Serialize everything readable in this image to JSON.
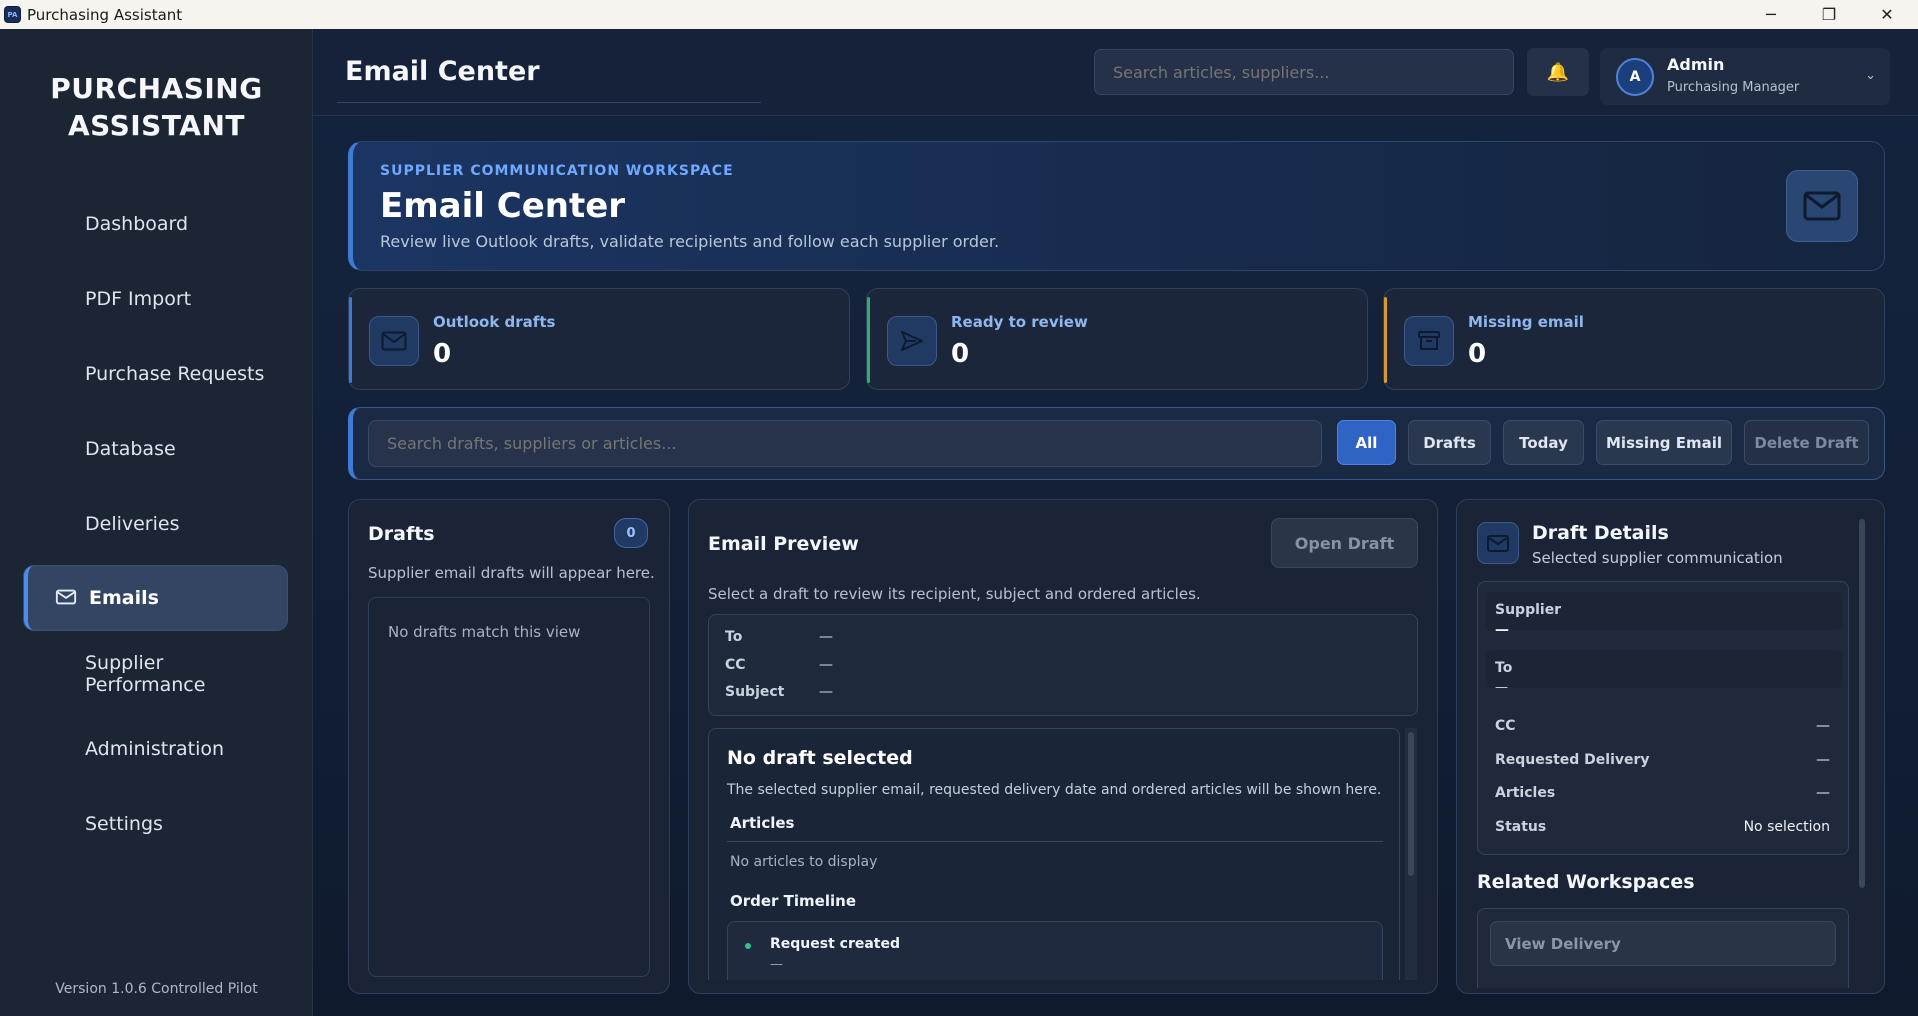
{
  "window": {
    "title": "Purchasing Assistant",
    "app_icon_text": "PA",
    "controls": {
      "minimize": "─",
      "maximize": "❐",
      "close": "✕"
    }
  },
  "sidebar": {
    "brand_line1": "PURCHASING",
    "brand_line2": "ASSISTANT",
    "items": [
      {
        "label": "Dashboard"
      },
      {
        "label": "PDF Import"
      },
      {
        "label": "Purchase Requests"
      },
      {
        "label": "Database"
      },
      {
        "label": "Deliveries"
      },
      {
        "label": "Emails",
        "active": true,
        "icon": "envelope-icon"
      },
      {
        "label": "Supplier Performance"
      },
      {
        "label": "Administration"
      },
      {
        "label": "Settings"
      }
    ],
    "version": "Version 1.0.6 Controlled Pilot"
  },
  "header": {
    "title": "Email Center",
    "search_placeholder": "Search articles, suppliers...",
    "bell_icon": "🔔",
    "user": {
      "initial": "A",
      "name": "Admin",
      "role": "Purchasing Manager",
      "chevron": "⌄"
    }
  },
  "hero": {
    "eyebrow": "SUPPLIER COMMUNICATION WORKSPACE",
    "title": "Email Center",
    "subtitle": "Review live Outlook drafts, validate recipients and follow each supplier order."
  },
  "stats": [
    {
      "label": "Outlook drafts",
      "value": "0",
      "accent": "#3e7bd6",
      "icon": "envelope-icon"
    },
    {
      "label": "Ready to review",
      "value": "0",
      "accent": "#2fae6b",
      "icon": "send-icon"
    },
    {
      "label": "Missing email",
      "value": "0",
      "accent": "#d99a2b",
      "icon": "archive-icon"
    }
  ],
  "filters": {
    "search_placeholder": "Search drafts, suppliers or articles...",
    "buttons": [
      "All",
      "Drafts",
      "Today",
      "Missing Email",
      "Delete Draft"
    ],
    "active": "All"
  },
  "drafts": {
    "title": "Drafts",
    "count": "0",
    "subtitle": "Supplier email drafts will appear here.",
    "empty": "No drafts match this view"
  },
  "preview": {
    "title": "Email Preview",
    "open_button": "Open Draft",
    "subtitle": "Select a draft to review its recipient, subject and ordered articles.",
    "fields": [
      {
        "label": "To",
        "value": "—"
      },
      {
        "label": "CC",
        "value": "—"
      },
      {
        "label": "Subject",
        "value": "—"
      }
    ],
    "no_selection_title": "No draft selected",
    "no_selection_text": "The selected supplier email, requested delivery date and ordered articles will be shown here.",
    "articles_heading": "Articles",
    "articles_empty": "No articles to display",
    "timeline_heading": "Order Timeline",
    "timeline": [
      {
        "label": "Request created",
        "value": "—"
      }
    ]
  },
  "details": {
    "title": "Draft Details",
    "subtitle": "Selected supplier communication",
    "supplier_label": "Supplier",
    "supplier_value": "—",
    "to_label": "To",
    "to_value": "—",
    "rows": [
      {
        "label": "CC",
        "value": "—"
      },
      {
        "label": "Requested Delivery",
        "value": "—"
      },
      {
        "label": "Articles",
        "value": "—"
      },
      {
        "label": "Status",
        "value": "No selection"
      }
    ],
    "related_title": "Related Workspaces",
    "related_button": "View Delivery"
  }
}
